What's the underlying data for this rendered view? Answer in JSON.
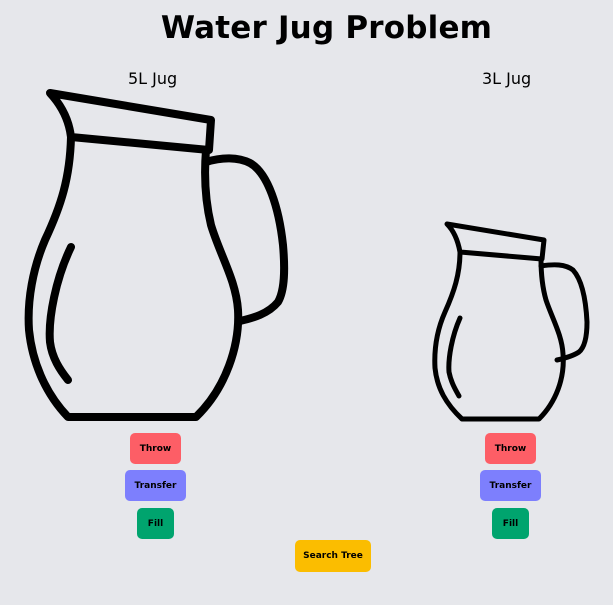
{
  "title": "Water Jug Problem",
  "jugs": [
    {
      "label": "5L Jug",
      "buttons": {
        "throw": "Throw",
        "transfer": "Transfer",
        "fill": "Fill"
      }
    },
    {
      "label": "3L Jug",
      "buttons": {
        "throw": "Throw",
        "transfer": "Transfer",
        "fill": "Fill"
      }
    }
  ],
  "search_button": "Search Tree",
  "colors": {
    "background": "#e6e7eb",
    "throw": "#fd5e66",
    "transfer": "#7d7ffd",
    "fill": "#00a46e",
    "search": "#fbbd00"
  },
  "icons": {
    "jug": "water-jug-outline-icon"
  }
}
